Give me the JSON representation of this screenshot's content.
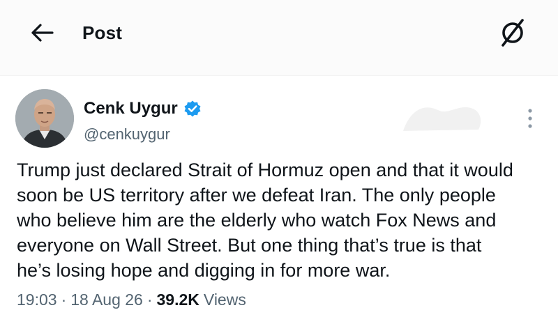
{
  "header": {
    "title": "Post",
    "back_icon": "arrow-left-icon",
    "grok_icon": "grok-slash-circle-icon"
  },
  "tweet": {
    "author_name": "Cenk Uygur",
    "author_handle": "@cenkuygur",
    "verified": true,
    "verified_color": "#1d9bf0",
    "text": "Trump just declared Strait of Hormuz open and that it would\nsoon be US territory after we defeat Iran. The only people\nwho believe him are the elderly who watch Fox News and\neveryone on Wall Street. But one thing that’s true is that\nhe’s losing hope and digging in for more war.",
    "time": "19:03",
    "date": "18 Aug 26",
    "separator": "·",
    "views_count": "39.2K",
    "views_label": "Views"
  },
  "colors": {
    "text_primary": "#0f1419",
    "text_secondary": "#536471",
    "background": "#ffffff"
  }
}
